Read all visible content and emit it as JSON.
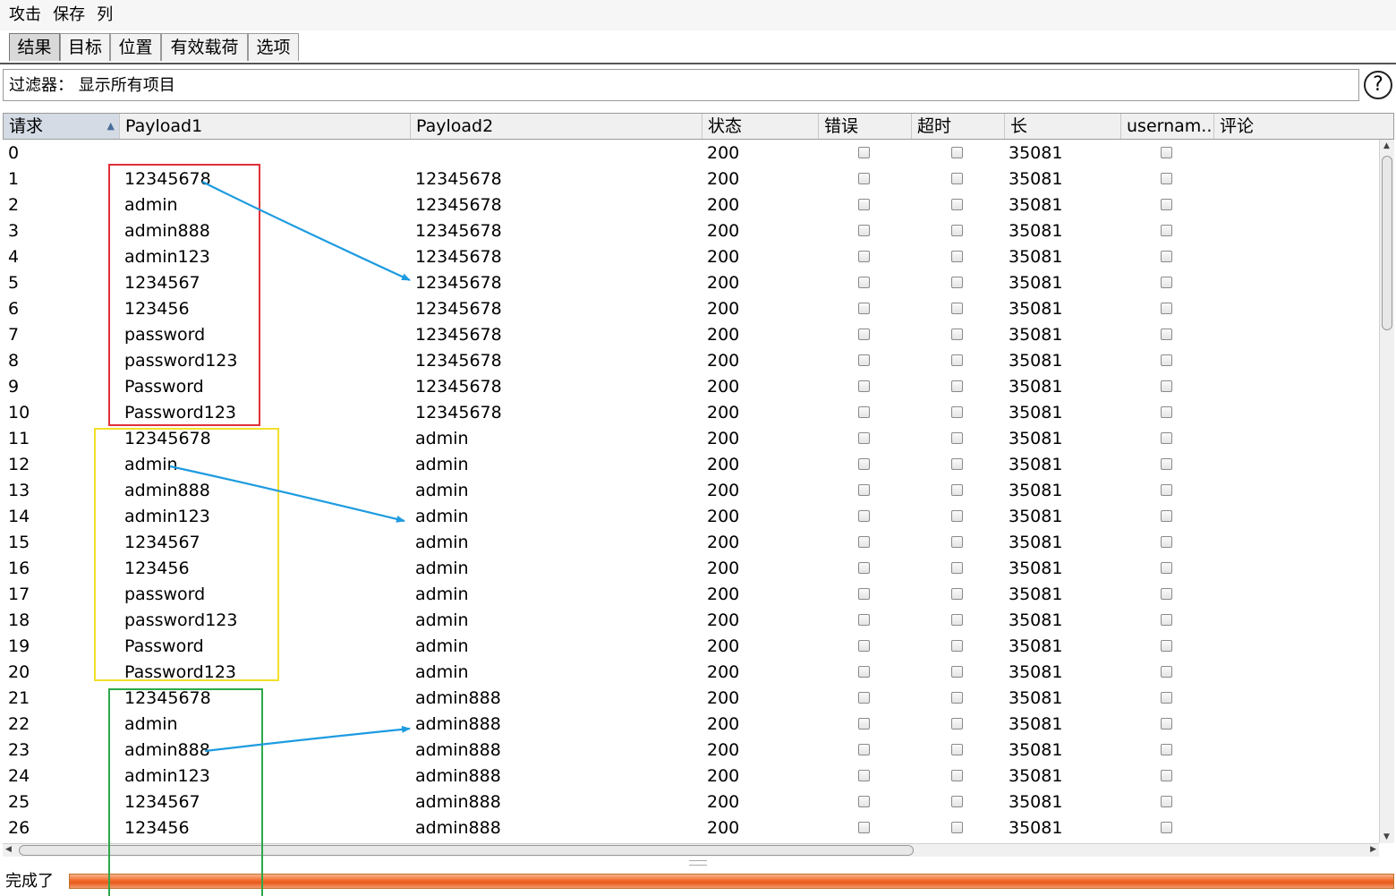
{
  "menu": [
    "攻击",
    "保存",
    "列"
  ],
  "tabs": [
    "结果",
    "目标",
    "位置",
    "有效载荷",
    "选项"
  ],
  "filter": {
    "text": "过滤器： 显示所有项目"
  },
  "help_icon": "question-mark-icon",
  "table": {
    "columns": [
      "请求",
      "Payload1",
      "Payload2",
      "状态",
      "错误",
      "超时",
      "长",
      "usernam...",
      "评论"
    ],
    "sorted_column": "请求",
    "rows": [
      {
        "req": "0",
        "p1": "",
        "p2": "",
        "status": "200",
        "len": "35081"
      },
      {
        "req": "1",
        "p1": "12345678",
        "p2": "12345678",
        "status": "200",
        "len": "35081"
      },
      {
        "req": "2",
        "p1": "admin",
        "p2": "12345678",
        "status": "200",
        "len": "35081"
      },
      {
        "req": "3",
        "p1": "admin888",
        "p2": "12345678",
        "status": "200",
        "len": "35081"
      },
      {
        "req": "4",
        "p1": "admin123",
        "p2": "12345678",
        "status": "200",
        "len": "35081"
      },
      {
        "req": "5",
        "p1": "1234567",
        "p2": "12345678",
        "status": "200",
        "len": "35081"
      },
      {
        "req": "6",
        "p1": "123456",
        "p2": "12345678",
        "status": "200",
        "len": "35081"
      },
      {
        "req": "7",
        "p1": "password",
        "p2": "12345678",
        "status": "200",
        "len": "35081"
      },
      {
        "req": "8",
        "p1": "password123",
        "p2": "12345678",
        "status": "200",
        "len": "35081"
      },
      {
        "req": "9",
        "p1": "Password",
        "p2": "12345678",
        "status": "200",
        "len": "35081"
      },
      {
        "req": "10",
        "p1": "Password123",
        "p2": "12345678",
        "status": "200",
        "len": "35081"
      },
      {
        "req": "11",
        "p1": "12345678",
        "p2": "admin",
        "status": "200",
        "len": "35081"
      },
      {
        "req": "12",
        "p1": "admin",
        "p2": "admin",
        "status": "200",
        "len": "35081"
      },
      {
        "req": "13",
        "p1": "admin888",
        "p2": "admin",
        "status": "200",
        "len": "35081"
      },
      {
        "req": "14",
        "p1": "admin123",
        "p2": "admin",
        "status": "200",
        "len": "35081"
      },
      {
        "req": "15",
        "p1": "1234567",
        "p2": "admin",
        "status": "200",
        "len": "35081"
      },
      {
        "req": "16",
        "p1": "123456",
        "p2": "admin",
        "status": "200",
        "len": "35081"
      },
      {
        "req": "17",
        "p1": "password",
        "p2": "admin",
        "status": "200",
        "len": "35081"
      },
      {
        "req": "18",
        "p1": "password123",
        "p2": "admin",
        "status": "200",
        "len": "35081"
      },
      {
        "req": "19",
        "p1": "Password",
        "p2": "admin",
        "status": "200",
        "len": "35081"
      },
      {
        "req": "20",
        "p1": "Password123",
        "p2": "admin",
        "status": "200",
        "len": "35081"
      },
      {
        "req": "21",
        "p1": "12345678",
        "p2": "admin888",
        "status": "200",
        "len": "35081"
      },
      {
        "req": "22",
        "p1": "admin",
        "p2": "admin888",
        "status": "200",
        "len": "35081"
      },
      {
        "req": "23",
        "p1": "admin888",
        "p2": "admin888",
        "status": "200",
        "len": "35081"
      },
      {
        "req": "24",
        "p1": "admin123",
        "p2": "admin888",
        "status": "200",
        "len": "35081"
      },
      {
        "req": "25",
        "p1": "1234567",
        "p2": "admin888",
        "status": "200",
        "len": "35081"
      },
      {
        "req": "26",
        "p1": "123456",
        "p2": "admin888",
        "status": "200",
        "len": "35081"
      }
    ]
  },
  "status_bar": {
    "text": "完成了",
    "progress": 1.0
  },
  "annotation_colors": {
    "group1": "#e0303a",
    "group2": "#f2df2a",
    "group3": "#2ca84a",
    "arrow": "#1d9be0"
  }
}
